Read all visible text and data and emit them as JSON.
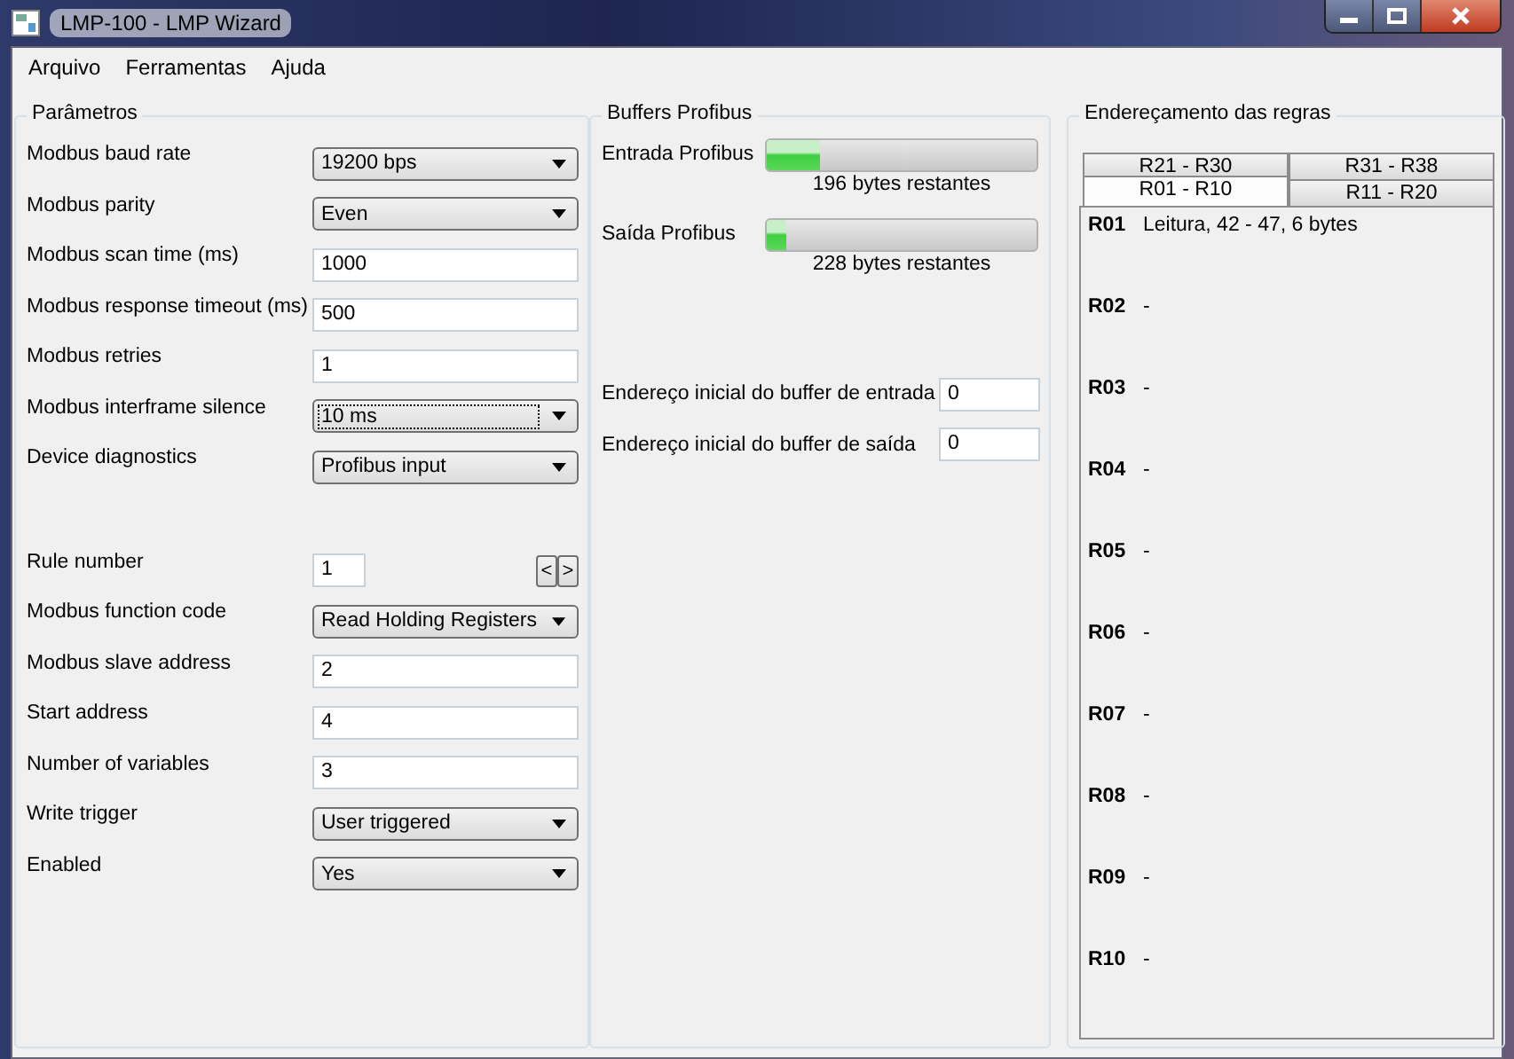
{
  "window": {
    "title": "LMP-100 - LMP Wizard"
  },
  "menu": [
    "Arquivo",
    "Ferramentas",
    "Ajuda"
  ],
  "parameters": {
    "title": "Parâmetros",
    "rows": [
      {
        "label": "Modbus baud rate",
        "kind": "select",
        "value": "19200 bps",
        "focused": false
      },
      {
        "label": "Modbus parity",
        "kind": "select",
        "value": "Even",
        "focused": false
      },
      {
        "label": "Modbus scan time (ms)",
        "kind": "input",
        "value": "1000"
      },
      {
        "label": "Modbus response timeout (ms)",
        "kind": "input",
        "value": "500"
      },
      {
        "label": "Modbus retries",
        "kind": "input",
        "value": "1"
      },
      {
        "label": "Modbus interframe silence",
        "kind": "select",
        "value": "10 ms",
        "focused": true
      },
      {
        "label": "Device diagnostics",
        "kind": "select",
        "value": "Profibus input",
        "focused": false
      },
      {
        "kind": "gap"
      },
      {
        "label": "Rule number",
        "kind": "spinner",
        "value": "1",
        "prev": "<",
        "next": ">"
      },
      {
        "label": "Modbus function code",
        "kind": "select",
        "value": "Read Holding Registers",
        "focused": false
      },
      {
        "label": "Modbus slave address",
        "kind": "input",
        "value": "2"
      },
      {
        "label": "Start address",
        "kind": "input",
        "value": "4"
      },
      {
        "label": "Number of variables",
        "kind": "input",
        "value": "3"
      },
      {
        "label": "Write trigger",
        "kind": "select",
        "value": "User triggered",
        "focused": false
      },
      {
        "label": "Enabled",
        "kind": "select",
        "value": "Yes",
        "focused": false
      }
    ]
  },
  "buffers": {
    "title": "Buffers Profibus",
    "bars": [
      {
        "label": "Entrada Profibus",
        "level": 0.2,
        "reading": "196 bytes restantes"
      },
      {
        "label": "Saída Profibus",
        "level": 0.07,
        "reading": "228 bytes restantes"
      }
    ],
    "fields": [
      {
        "label": "Endereço inicial do buffer de entrada",
        "value": "0"
      },
      {
        "label": "Endereço inicial do buffer de saída",
        "value": "0"
      }
    ]
  },
  "rules": {
    "title": "Endereçamento das regras",
    "tab_rows": [
      [
        {
          "label": "R21 - R30",
          "selected": false
        },
        {
          "label": "R31 - R38",
          "selected": false
        }
      ],
      [
        {
          "label": "R01 - R10",
          "selected": true
        },
        {
          "label": "R11 - R20",
          "selected": false
        }
      ]
    ],
    "items": [
      {
        "code": "R01",
        "text": "Leitura, 42 - 47, 6 bytes"
      },
      {
        "code": "R02",
        "text": "-"
      },
      {
        "code": "R03",
        "text": "-"
      },
      {
        "code": "R04",
        "text": "-"
      },
      {
        "code": "R05",
        "text": "-"
      },
      {
        "code": "R06",
        "text": "-"
      },
      {
        "code": "R07",
        "text": "-"
      },
      {
        "code": "R08",
        "text": "-"
      },
      {
        "code": "R09",
        "text": "-"
      },
      {
        "code": "R10",
        "text": "-"
      }
    ]
  }
}
